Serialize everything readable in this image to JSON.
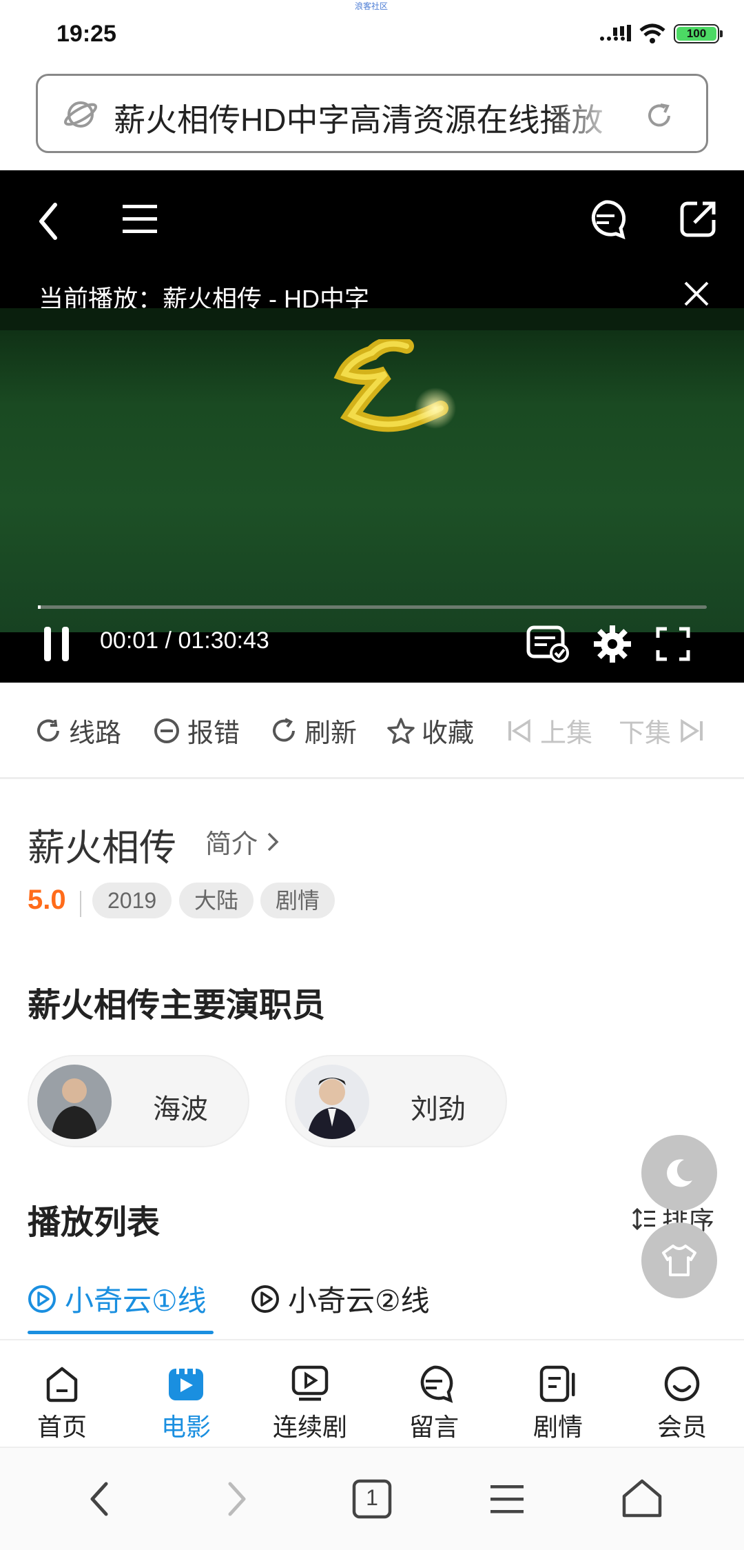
{
  "status": {
    "time": "19:25",
    "tiny_text": "浪客社区",
    "battery": "100"
  },
  "url": {
    "text": "薪火相传HD中字高清资源在线播放"
  },
  "player": {
    "now_playing": "当前播放：薪火相传 - HD中字",
    "time_current": "00:01",
    "time_total": "01:30:43",
    "progress": 0.004
  },
  "actions": {
    "route": "线路",
    "report": "报错",
    "refresh": "刷新",
    "favorite": "收藏",
    "prev": "上集",
    "next": "下集"
  },
  "info": {
    "title": "薪火相传",
    "intro": "简介",
    "rating": "5.0",
    "tags": [
      "2019",
      "大陆",
      "剧情"
    ]
  },
  "cast": {
    "heading": "薪火相传主要演职员",
    "members": [
      {
        "name": "海波"
      },
      {
        "name": "刘劲"
      }
    ]
  },
  "playlist": {
    "heading": "播放列表",
    "sort": "排序",
    "lines": [
      {
        "label": "小奇云①线",
        "active": true
      },
      {
        "label": "小奇云②线",
        "active": false
      }
    ]
  },
  "nav": {
    "items": [
      {
        "label": "首页",
        "icon": "home-icon"
      },
      {
        "label": "电影",
        "icon": "movie-icon",
        "active": true
      },
      {
        "label": "连续剧",
        "icon": "tv-series-icon"
      },
      {
        "label": "留言",
        "icon": "message-icon"
      },
      {
        "label": "剧情",
        "icon": "plot-icon"
      },
      {
        "label": "会员",
        "icon": "member-icon"
      }
    ]
  },
  "browser": {
    "tab_count": "1"
  },
  "colors": {
    "accent": "#1a8fe0",
    "rating": "#ff6b1a",
    "video_bg": "#1d5026"
  }
}
